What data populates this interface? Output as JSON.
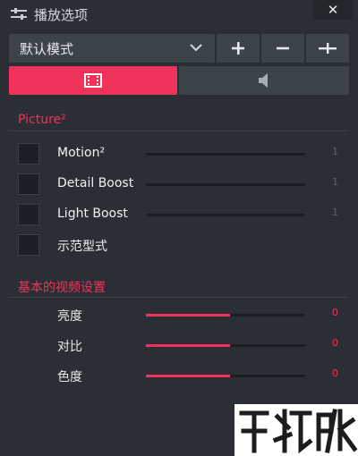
{
  "window": {
    "title": "播放选项",
    "close_label": "✕"
  },
  "toolbar": {
    "preset_value": "默认模式",
    "add_label": "+",
    "remove_label": "−",
    "more_label": "-|-"
  },
  "tabs": [
    {
      "name": "video",
      "icon": "film-icon",
      "active": true
    },
    {
      "name": "audio",
      "icon": "speaker-icon",
      "active": false
    }
  ],
  "picture_section": {
    "title": "Picture²",
    "items": [
      {
        "label": "Motion²",
        "value": "1",
        "level": 0
      },
      {
        "label": "Detail Boost",
        "value": "1",
        "level": 0
      },
      {
        "label": "Light Boost",
        "value": "1",
        "level": 0
      },
      {
        "label": "示范型式"
      }
    ]
  },
  "basic_section": {
    "title": "基本的视频设置",
    "items": [
      {
        "label": "亮度",
        "value": "0",
        "level": 0.53
      },
      {
        "label": "对比",
        "value": "0",
        "level": 0.53
      },
      {
        "label": "色度",
        "value": "0",
        "level": 0.53
      }
    ]
  },
  "colors": {
    "accent": "#f0325c",
    "background": "#2b2f35",
    "control": "#3c434b"
  }
}
